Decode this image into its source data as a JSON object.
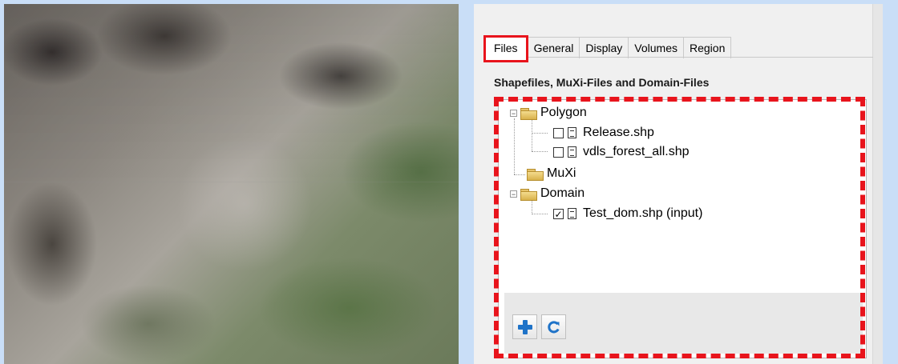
{
  "tabs": [
    {
      "label": "Files",
      "active": true
    },
    {
      "label": "General",
      "active": false
    },
    {
      "label": "Display",
      "active": false
    },
    {
      "label": "Volumes",
      "active": false
    },
    {
      "label": "Region",
      "active": false
    }
  ],
  "section_title": "Shapefiles, MuXi-Files and Domain-Files",
  "tree": {
    "polygon": {
      "label": "Polygon",
      "expander": "−"
    },
    "release": {
      "label": "Release.shp",
      "checked": false
    },
    "forest": {
      "label": "vdls_forest_all.shp",
      "checked": false
    },
    "muxi": {
      "label": "MuXi"
    },
    "domain": {
      "label": "Domain",
      "expander": "−"
    },
    "testdom": {
      "label": "Test_dom.shp (input)",
      "checked": true,
      "check_glyph": "✓"
    }
  },
  "toolbar": {
    "add_icon": "plus-icon",
    "refresh_icon": "refresh-icon"
  },
  "colors": {
    "highlight": "#e8141c",
    "accent_blue": "#1f73c8",
    "frame_bg": "#c9def7"
  }
}
